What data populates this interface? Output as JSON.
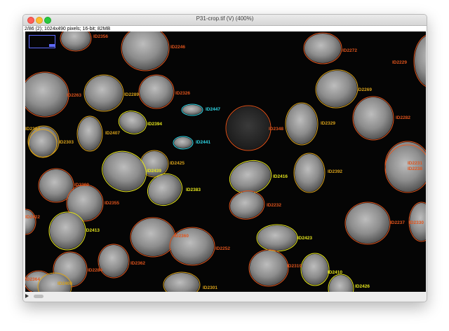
{
  "window": {
    "title": "P31-crop.tif (V) (400%)",
    "info": "2/86 (2); 1024x490 pixels; 16-bit; 82MB"
  },
  "colors": {
    "orange": "#e0541c",
    "amber": "#d8a11a",
    "yellow": "#e4e41c",
    "cyan": "#2fd8e8"
  },
  "cells": [
    {
      "id": "ID2356",
      "color": "orange"
    },
    {
      "id": "ID2246",
      "color": "orange"
    },
    {
      "id": "ID2272",
      "color": "orange"
    },
    {
      "id": "ID2229",
      "color": "orange"
    },
    {
      "id": "ID2263",
      "color": "orange"
    },
    {
      "id": "ID2289",
      "color": "amber"
    },
    {
      "id": "ID2326",
      "color": "orange"
    },
    {
      "id": "ID2447",
      "color": "cyan"
    },
    {
      "id": "ID2269",
      "color": "amber"
    },
    {
      "id": "ID2282",
      "color": "orange"
    },
    {
      "id": "ID2394",
      "color": "yellow"
    },
    {
      "id": "ID2407",
      "color": "amber"
    },
    {
      "id": "ID2348",
      "color": "orange"
    },
    {
      "id": "ID2329",
      "color": "amber"
    },
    {
      "id": "ID2384",
      "color": "amber"
    },
    {
      "id": "ID2303",
      "color": "amber"
    },
    {
      "id": "ID2441",
      "color": "cyan"
    },
    {
      "id": "ID2425",
      "color": "amber"
    },
    {
      "id": "ID2439",
      "color": "yellow"
    },
    {
      "id": "ID2231",
      "color": "orange"
    },
    {
      "id": "ID2238",
      "color": "orange"
    },
    {
      "id": "ID2416",
      "color": "yellow"
    },
    {
      "id": "ID2392",
      "color": "amber"
    },
    {
      "id": "ID2380",
      "color": "orange"
    },
    {
      "id": "ID2383",
      "color": "yellow"
    },
    {
      "id": "ID2355",
      "color": "orange"
    },
    {
      "id": "ID2232",
      "color": "orange"
    },
    {
      "id": "ID2422",
      "color": "orange"
    },
    {
      "id": "ID2413",
      "color": "yellow"
    },
    {
      "id": "ID2237",
      "color": "orange"
    },
    {
      "id": "ID2330",
      "color": "orange"
    },
    {
      "id": "ID2360",
      "color": "orange"
    },
    {
      "id": "ID2252",
      "color": "orange"
    },
    {
      "id": "ID2423",
      "color": "yellow"
    },
    {
      "id": "ID2284",
      "color": "orange"
    },
    {
      "id": "ID2362",
      "color": "orange"
    },
    {
      "id": "ID2319",
      "color": "orange"
    },
    {
      "id": "ID2410",
      "color": "yellow"
    },
    {
      "id": "ID2364",
      "color": "orange"
    },
    {
      "id": "ID2408",
      "color": "amber"
    },
    {
      "id": "ID2301",
      "color": "amber"
    },
    {
      "id": "ID2426",
      "color": "yellow"
    }
  ]
}
